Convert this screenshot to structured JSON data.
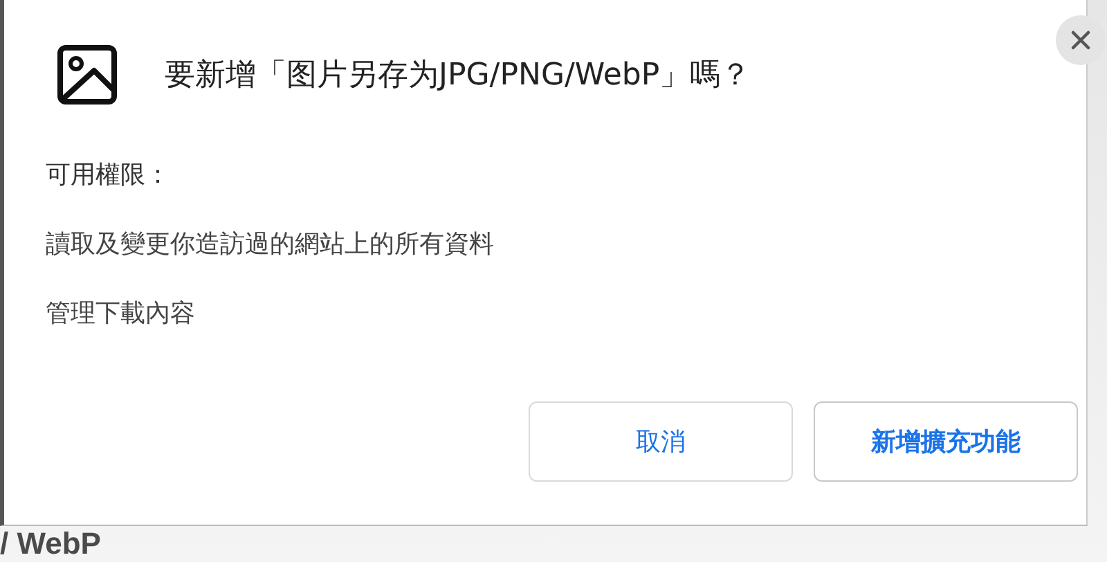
{
  "dialog": {
    "title": "要新增「图片另存为JPG/PNG/WebP」嗎？",
    "permissions_heading": "可用權限：",
    "permissions": [
      "讀取及變更你造訪過的網站上的所有資料",
      "管理下載內容"
    ],
    "buttons": [
      {
        "label": "取消",
        "kind": "secondary"
      },
      {
        "label": "新增擴充功能",
        "kind": "primary"
      }
    ]
  },
  "background_text": "/ WebP"
}
